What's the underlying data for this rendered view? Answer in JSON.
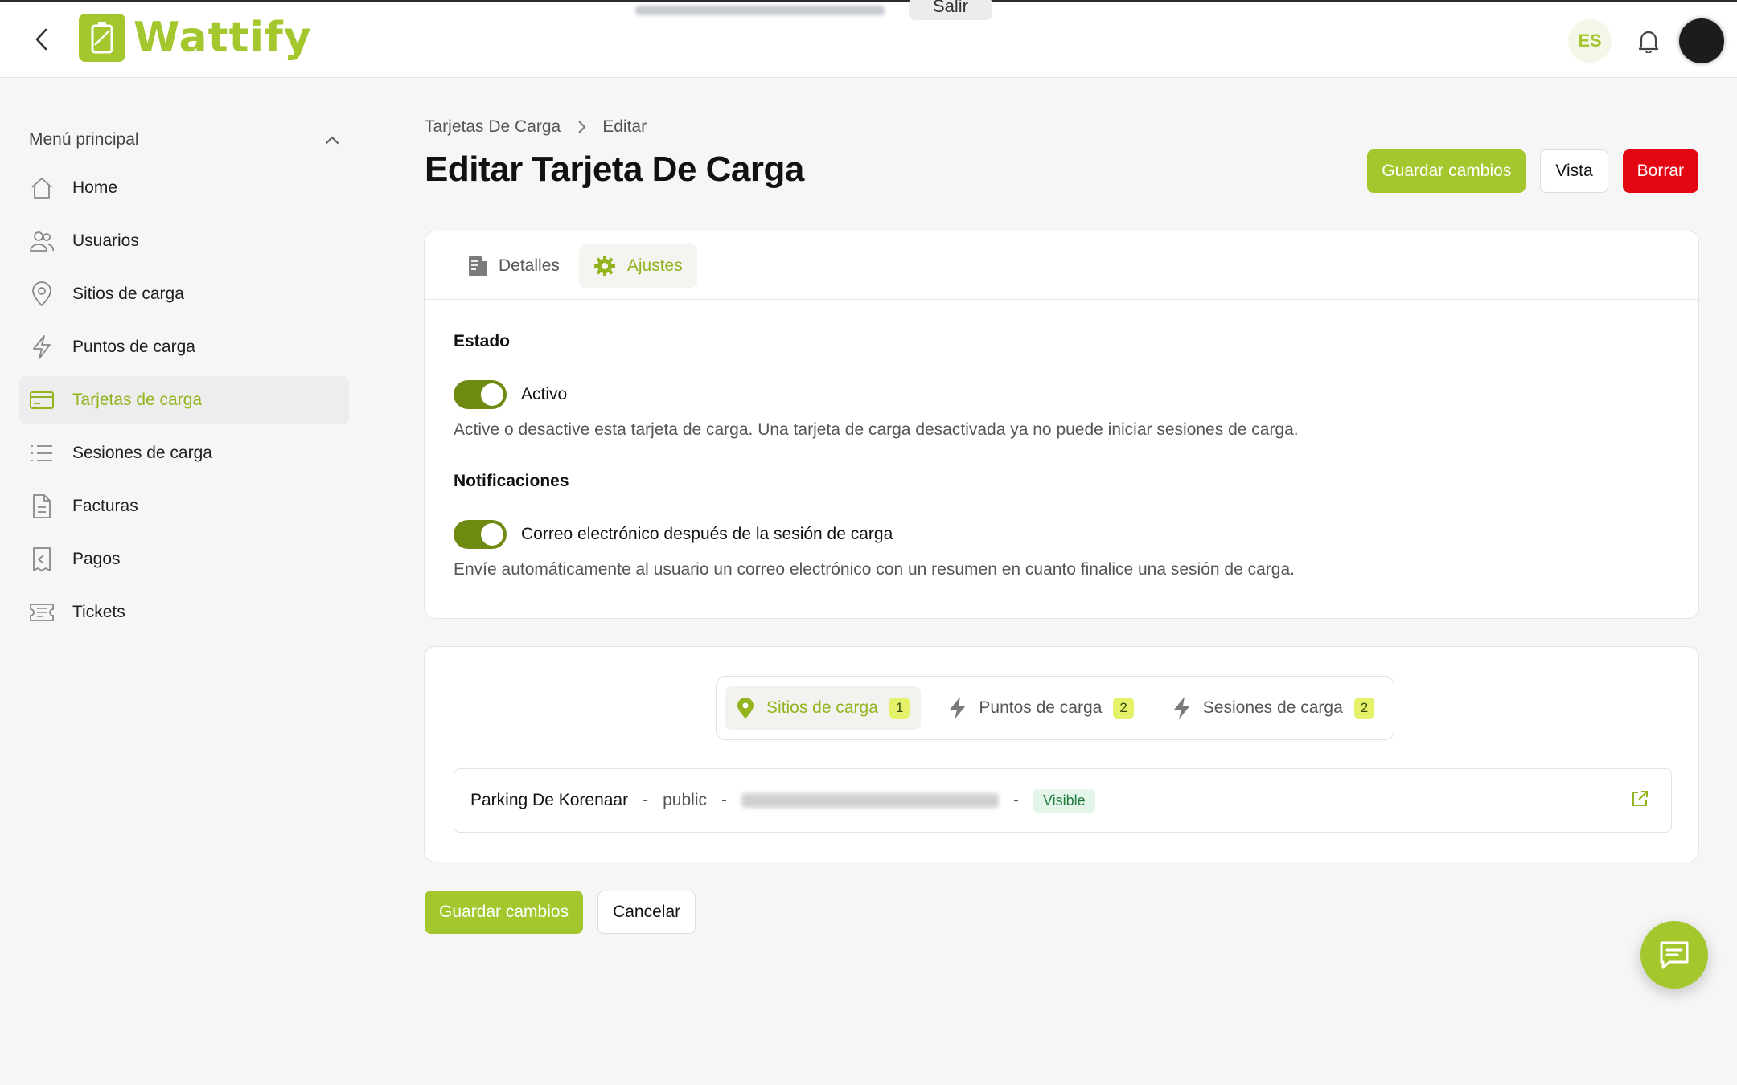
{
  "app": {
    "name": "Wattify",
    "language": "ES",
    "exit_label": "Salir"
  },
  "colors": {
    "accent": "#a3c72c",
    "danger": "#e30613",
    "toggle_on": "#6e8a10"
  },
  "sidebar": {
    "title": "Menú principal",
    "items": [
      {
        "label": "Home",
        "icon": "home-icon"
      },
      {
        "label": "Usuarios",
        "icon": "users-icon"
      },
      {
        "label": "Sitios de carga",
        "icon": "map-pin-icon"
      },
      {
        "label": "Puntos de carga",
        "icon": "bolt-icon"
      },
      {
        "label": "Tarjetas de carga",
        "icon": "credit-card-icon",
        "active": true
      },
      {
        "label": "Sesiones de carga",
        "icon": "list-icon"
      },
      {
        "label": "Facturas",
        "icon": "document-icon"
      },
      {
        "label": "Pagos",
        "icon": "receipt-icon"
      },
      {
        "label": "Tickets",
        "icon": "ticket-icon"
      }
    ]
  },
  "breadcrumb": {
    "parent": "Tarjetas De Carga",
    "current": "Editar"
  },
  "page": {
    "title": "Editar Tarjeta De Carga"
  },
  "actions": {
    "save": "Guardar cambios",
    "view": "Vista",
    "delete": "Borrar",
    "cancel": "Cancelar"
  },
  "tabs": [
    {
      "label": "Detalles",
      "icon": "document-icon"
    },
    {
      "label": "Ajustes",
      "icon": "gear-icon",
      "active": true
    }
  ],
  "settings": {
    "status": {
      "title": "Estado",
      "toggle_label": "Activo",
      "enabled": true,
      "description": "Active o desactive esta tarjeta de carga. Una tarjeta de carga desactivada ya no puede iniciar sesiones de carga."
    },
    "notifications": {
      "title": "Notificaciones",
      "toggle_label": "Correo electrónico después de la sesión de carga",
      "enabled": true,
      "description": "Envíe automáticamente al usuario un correo electrónico con un resumen en cuanto finalice una sesión de carga."
    }
  },
  "related": {
    "tabs": [
      {
        "label": "Sitios de carga",
        "count": "1",
        "active": true
      },
      {
        "label": "Puntos de carga",
        "count": "2"
      },
      {
        "label": "Sesiones de carga",
        "count": "2"
      }
    ],
    "rows": [
      {
        "name": "Parking De Korenaar",
        "access": "public",
        "separator": "-",
        "status": "Visible"
      }
    ]
  }
}
